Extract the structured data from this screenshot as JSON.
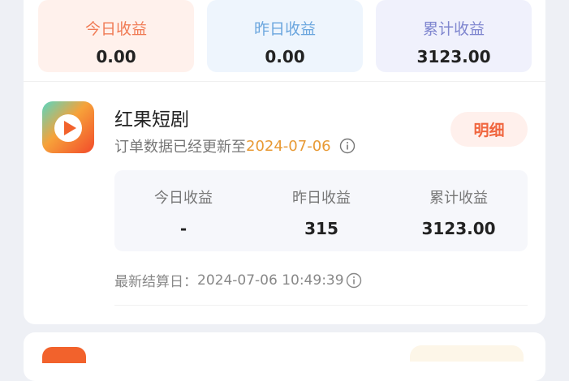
{
  "summary": {
    "today_label": "今日收益",
    "today_value": "0.00",
    "yesterday_label": "昨日收益",
    "yesterday_value": "0.00",
    "total_label": "累计收益",
    "total_value": "3123.00"
  },
  "app": {
    "name": "红果短剧",
    "update_prefix": "订单数据已经更新至",
    "update_date": "2024-07-06",
    "detail_label": "明细",
    "stats": {
      "today_label": "今日收益",
      "today_value": "-",
      "yesterday_label": "昨日收益",
      "yesterday_value": "315",
      "total_label": "累计收益",
      "total_value": "3123.00"
    },
    "settle_label": "最新结算日：",
    "settle_time": "2024-07-06 10:49:39"
  },
  "colors": {
    "accent_orange": "#f0663f",
    "date_orange": "#e89a35",
    "blue_label": "#6ba6de",
    "purple_label": "#7f86cf"
  },
  "icons": {
    "app_logo": "play-logo-icon",
    "info": "info-icon"
  }
}
